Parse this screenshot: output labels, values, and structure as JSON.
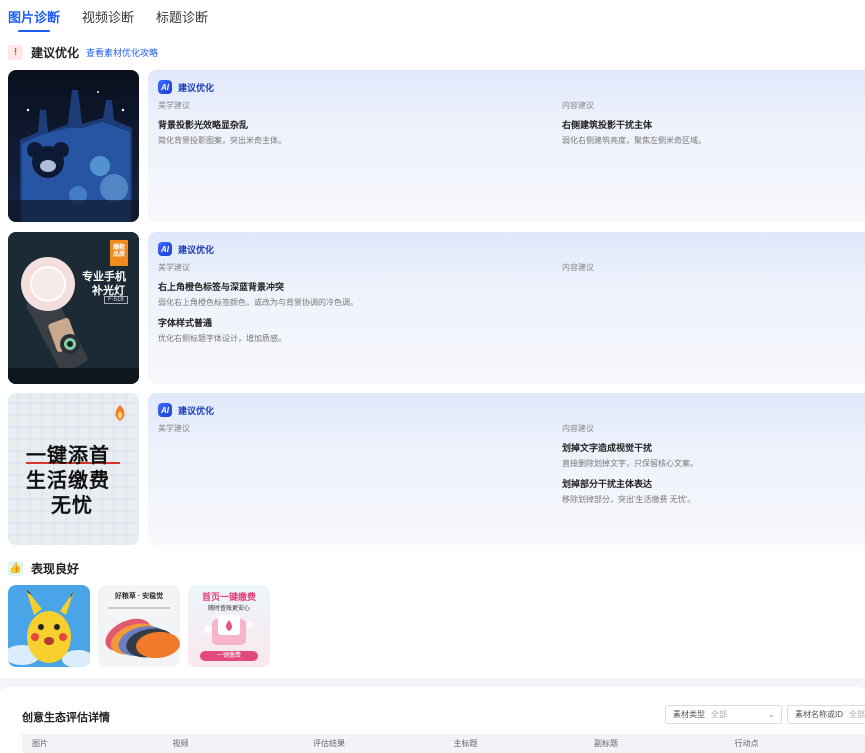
{
  "tabs": [
    {
      "label": "图片诊断",
      "active": true
    },
    {
      "label": "视频诊断",
      "active": false
    },
    {
      "label": "标题诊断",
      "active": false
    }
  ],
  "suggest_section": {
    "icon": "!",
    "title": "建议优化",
    "link": "查看素材优化攻略"
  },
  "cards": [
    {
      "head": "建议优化",
      "left_label": "美学建议",
      "left_items": [
        {
          "title": "背景投影光效略显杂乱",
          "desc": "简化背景投影图案，突出米奇主体。"
        }
      ],
      "right_label": "内容建议",
      "right_items": [
        {
          "title": "右侧建筑投影干扰主体",
          "desc": "弱化右侧建筑亮度，聚焦左侧米奇区域。"
        }
      ]
    },
    {
      "head": "建议优化",
      "left_label": "美学建议",
      "left_items": [
        {
          "title": "右上角橙色标签与深蓝背景冲突",
          "desc": "弱化右上角橙色标签颜色，或改为与背景协调的冷色调。"
        },
        {
          "title": "字体样式普通",
          "desc": "优化右侧标题字体设计，增加质感。"
        }
      ],
      "right_label": "内容建议",
      "right_items": []
    },
    {
      "head": "建议优化",
      "left_label": "美学建议",
      "left_items": [],
      "right_label": "内容建议",
      "right_items": [
        {
          "title": "划掉文字造成视觉干扰",
          "desc": "直接删除划掉文字，只保留核心文案。"
        },
        {
          "title": "划掉部分干扰主体表达",
          "desc": "移除划掉部分，突出'生活缴费 无忧'。"
        }
      ]
    }
  ],
  "thumb2": {
    "badge": "爆款\n品质",
    "line1": "专业手机",
    "line2": "补光灯",
    "model": "F-518"
  },
  "thumb3": {
    "line1": "一键添首",
    "line2": "生活缴费",
    "line3": "无忧"
  },
  "good_section": {
    "icon": "👍",
    "title": "表现良好"
  },
  "good_thumbs": {
    "t2_title": "好粮草 · 安稳觉",
    "t3_title": "首页一键缴费",
    "t3_sub": "随时查账更安心",
    "t3_btn": "一键缴费"
  },
  "bottom": {
    "title": "创意生态评估详情",
    "filter1_label": "素材类型",
    "filter1_value": "全部",
    "filter2_label": "素材名称或ID",
    "filter2_value": "全部",
    "columns": [
      "图片",
      "视频",
      "评估结果",
      "主标题",
      "副标题",
      "行动点"
    ]
  }
}
